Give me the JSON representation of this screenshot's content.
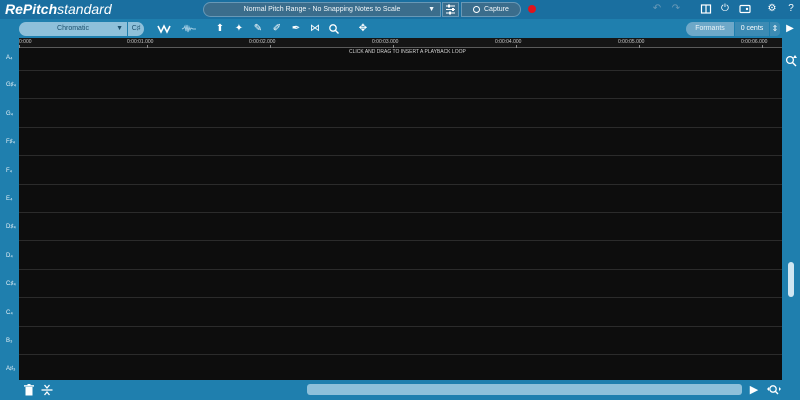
{
  "app": {
    "brand": "RePitch",
    "edition": "standard"
  },
  "header": {
    "mode_label": "Normal Pitch Range - No Snapping Notes to Scale",
    "capture_label": "Capture"
  },
  "toolbar": {
    "scale_value": "Chromatic",
    "key_label": "C♯",
    "formants_label": "Formants",
    "cents_value": "0 cents"
  },
  "ruler": {
    "ticks": [
      "0:000",
      "0:00:01.000",
      "0:00:02.000",
      "0:00:03.000",
      "0:00:04.000",
      "0:00:05.000",
      "0:00:06.000"
    ]
  },
  "grid": {
    "hint": "CLICK AND DRAG TO INSERT A PLAYBACK LOOP"
  },
  "notes": [
    "A₄",
    "G♯₄",
    "G₄",
    "F♯₄",
    "F₄",
    "E₄",
    "D♯₄",
    "D₄",
    "C♯₄",
    "C₄",
    "B₃",
    "A♯₃"
  ],
  "colors": {
    "accent": "#1f7fae",
    "record": "#e0141c",
    "editor_background": "#0d0d0d"
  }
}
